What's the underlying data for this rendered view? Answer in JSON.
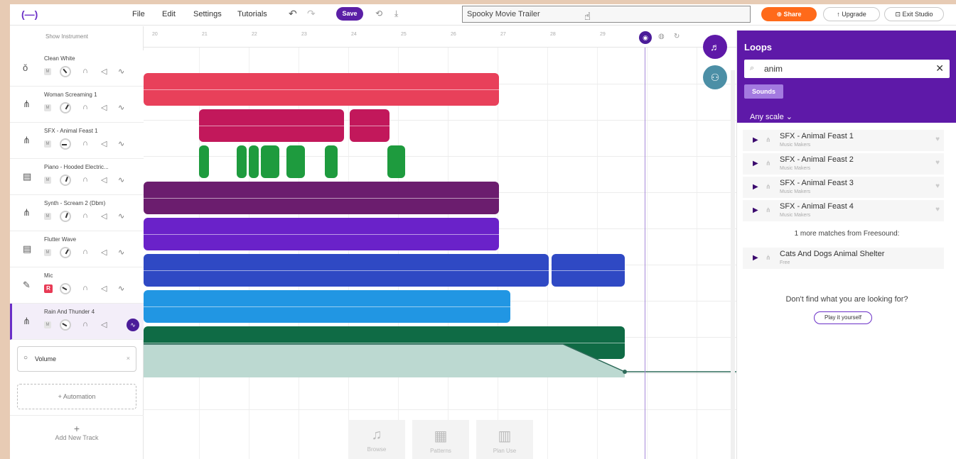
{
  "topbar": {
    "logo": "(—)",
    "menu": [
      "File",
      "Edit",
      "Settings",
      "Tutorials"
    ],
    "save_label": "Save",
    "project_title": "Spooky Movie Trailer",
    "share_label": "⊕ Share",
    "upgrade_label": "↑ Upgrade",
    "exit_label": "⊡ Exit Studio"
  },
  "tracks_panel": {
    "show_instrument": "Show Instrument",
    "tracks": [
      {
        "name": "Clean White",
        "icon": "synth-icon"
      },
      {
        "name": "Woman Screaming 1",
        "icon": "waveform-icon"
      },
      {
        "name": "SFX - Animal Feast 1",
        "icon": "waveform-icon"
      },
      {
        "name": "Piano - Hooded Electric...",
        "icon": "keyboard-icon"
      },
      {
        "name": "Synth - Scream 2 (Dbm)",
        "icon": "waveform-icon"
      },
      {
        "name": "Flutter Wave",
        "icon": "keyboard-icon"
      },
      {
        "name": "Mic",
        "icon": "mic-icon"
      },
      {
        "name": "Rain And Thunder 4",
        "icon": "waveform-icon"
      }
    ],
    "volume_label": "Volume",
    "automation_label": "+ Automation",
    "add_track_label": "Add New Track"
  },
  "timeline": {
    "ruler": [
      "20",
      "21",
      "22",
      "23",
      "24",
      "25",
      "26",
      "27",
      "28",
      "29"
    ]
  },
  "bottom_tools": [
    {
      "label": "Browse",
      "icon": "music-note-icon"
    },
    {
      "label": "Patterns",
      "icon": "patterns-icon"
    },
    {
      "label": "Plan Use",
      "icon": "grid-icon"
    }
  ],
  "loops_panel": {
    "title": "Loops",
    "search_value": "anim",
    "chip": "Sounds",
    "scale": "Any scale",
    "items": [
      {
        "name": "SFX - Animal Feast 1",
        "source": "Music Makers"
      },
      {
        "name": "SFX - Animal Feast 2",
        "source": "Music Makers"
      },
      {
        "name": "SFX - Animal Feast 3",
        "source": "Music Makers"
      },
      {
        "name": "SFX - Animal Feast 4",
        "source": "Music Makers"
      }
    ],
    "more_matches": "1 more matches from Freesound:",
    "freesound_item": {
      "name": "Cats And Dogs Animal Shelter",
      "source": "Free"
    },
    "not_found": "Don't find what you are looking for?",
    "play_yourself": "Play it yourself"
  },
  "colors": {
    "brand_purple": "#5e19a8",
    "share_orange": "#ff6a1a",
    "track_red": "#e8405a",
    "track_magenta": "#c2185b",
    "track_green": "#1e9b3e",
    "track_plum": "#6b1d6e",
    "track_violet": "#6a22c9",
    "track_blue": "#2f49c4",
    "track_sky": "#2196e3",
    "track_teal": "#0f6b45"
  }
}
